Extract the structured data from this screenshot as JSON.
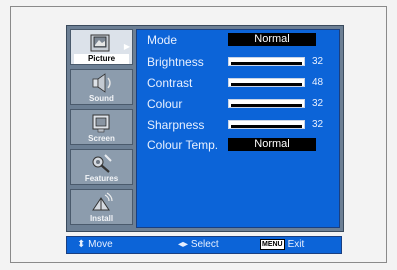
{
  "sidebar": {
    "items": [
      {
        "label": "Picture",
        "icon": "picture-icon",
        "active": true
      },
      {
        "label": "Sound",
        "icon": "sound-icon",
        "active": false
      },
      {
        "label": "Screen",
        "icon": "screen-icon",
        "active": false
      },
      {
        "label": "Features",
        "icon": "features-icon",
        "active": false
      },
      {
        "label": "Install",
        "icon": "install-icon",
        "active": false
      }
    ]
  },
  "menu": {
    "rows": [
      {
        "label": "Mode",
        "value": "Normal"
      },
      {
        "label": "Brightness",
        "value": "32",
        "level": 0.32
      },
      {
        "label": "Contrast",
        "value": "48",
        "level": 0.48
      },
      {
        "label": "Colour",
        "value": "32",
        "level": 0.32
      },
      {
        "label": "Sharpness",
        "value": "32",
        "level": 0.32
      },
      {
        "label": "Colour Temp.",
        "value": "Normal"
      }
    ]
  },
  "footer": {
    "move": "Move",
    "select": "Select",
    "menu_key": "MENU",
    "exit": "Exit"
  },
  "colors": {
    "panel": "#0c64d8",
    "sidebar": "#8c9cad",
    "osd": "#6c7f94"
  }
}
